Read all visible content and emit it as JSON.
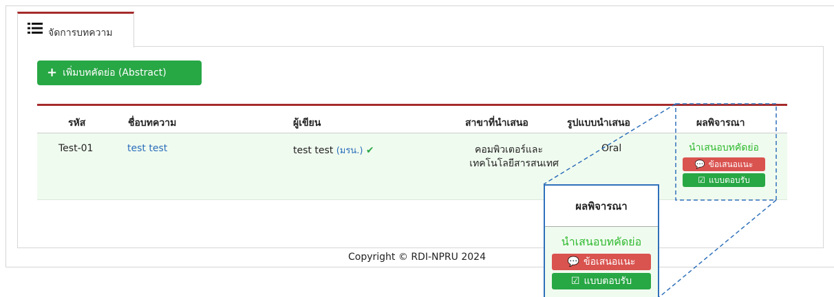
{
  "tab": {
    "label": "จัดการบทความ",
    "icon": "list-icon"
  },
  "add_button": {
    "label": "เพิ่มบทคัดย่อ (Abstract)",
    "icon": "plus-icon"
  },
  "table": {
    "headers": [
      "รหัส",
      "ชื่อบทความ",
      "ผู้เขียน",
      "สาขาที่นำเสนอ",
      "รูปแบบนำเสนอ",
      "ผลพิจารณา"
    ],
    "rows": [
      {
        "code": "Test-01",
        "title": "test test",
        "author": "test test",
        "author_org": "(มรน.)",
        "field_line1": "คอมพิวเตอร์และ",
        "field_line2": "เทคโนโลยีสารสนเทศ",
        "format": "Oral",
        "result": "นำเสนอบทคัดย่อ",
        "suggest_label": "ข้อเสนอแนะ",
        "accept_label": "แบบตอบรับ"
      }
    ]
  },
  "footer": {
    "text": "Copyright © RDI-NPRU 2024"
  },
  "zoom": {
    "header": "ผลพิจารณา",
    "result": "นำเสนอบทคัดย่อ",
    "suggest_label": "ข้อเสนอแนะ",
    "accept_label": "แบบตอบรับ"
  },
  "colors": {
    "accent_red": "#a52a2a",
    "button_green": "#28a745",
    "pill_red": "#d9534f",
    "link_blue": "#2a6ebb",
    "callout_blue": "#2d6fba"
  }
}
